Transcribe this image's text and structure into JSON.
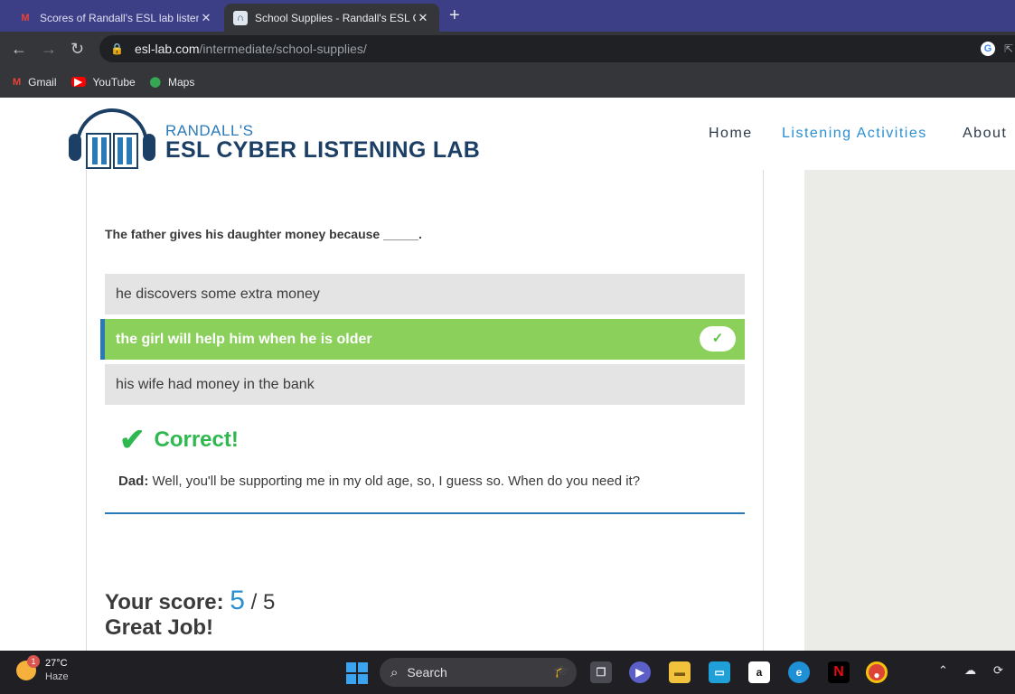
{
  "browser": {
    "tabs": [
      {
        "title": "Scores of Randall's ESL lab listen",
        "favicon": "gmail-icon"
      },
      {
        "title": "School Supplies - Randall's ESL C",
        "favicon": "site-icon"
      }
    ],
    "url_host": "esl-lab.com",
    "url_path": "/intermediate/school-supplies/",
    "bookmarks": [
      {
        "label": "Gmail",
        "icon": "gmail-icon"
      },
      {
        "label": "YouTube",
        "icon": "youtube-icon"
      },
      {
        "label": "Maps",
        "icon": "maps-icon"
      }
    ]
  },
  "site": {
    "brand_small": "RANDALL'S",
    "brand_big": "ESL CYBER LISTENING LAB",
    "nav": [
      "Home",
      "Listening Activities",
      "About"
    ]
  },
  "quiz": {
    "question": "The father gives his daughter money because _____.",
    "options": [
      {
        "text": "he discovers some extra money",
        "selected": false
      },
      {
        "text": "the girl will help him when he is older",
        "selected": true
      },
      {
        "text": "his wife had money in the bank",
        "selected": false
      }
    ],
    "feedback": "Correct!",
    "speaker": "Dad:",
    "line": "Well, you'll be supporting me in my old age, so, I guess so. When do you need it?",
    "score_label": "Your score:",
    "score_value": "5",
    "score_total": "/ 5",
    "message": "Great Job!"
  },
  "taskbar": {
    "temp": "27°C",
    "condition": "Haze",
    "badge": "1",
    "search_label": "Search"
  },
  "colors": {
    "accent": "#2a8fd0",
    "correct_green": "#8ad05a",
    "brand_dark": "#1c3f66"
  }
}
